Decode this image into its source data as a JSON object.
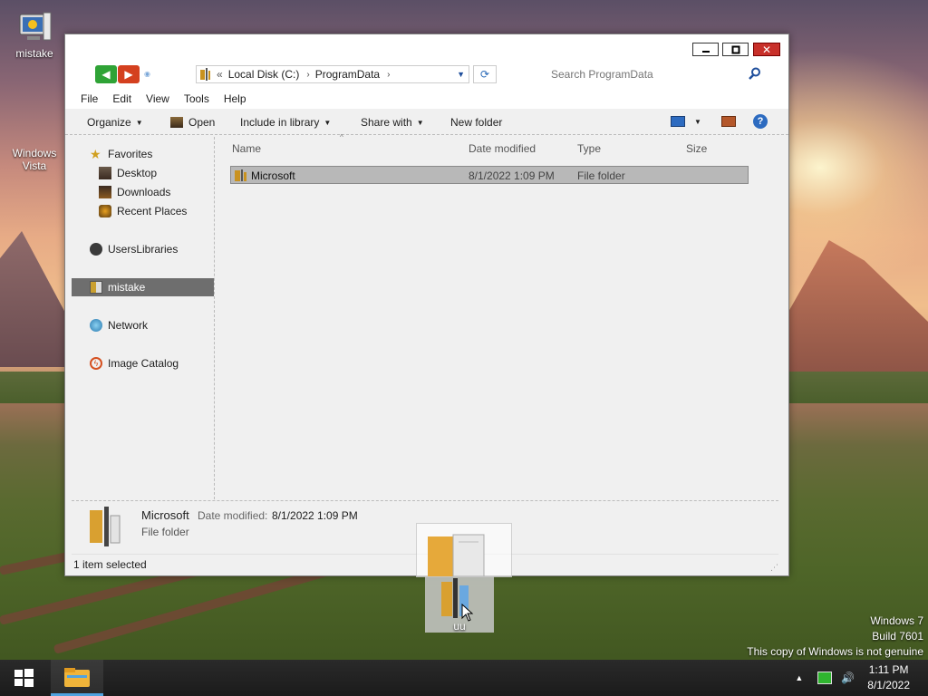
{
  "desktop": {
    "icons": [
      {
        "label": "mistake",
        "icon": "computer-icon"
      },
      {
        "label": "Windows Vista",
        "icon": "text-shortcut"
      }
    ],
    "watermark": {
      "line1": "Windows 7",
      "line2": "Build 7601",
      "line3": "This copy of Windows is not genuine"
    }
  },
  "explorer": {
    "address": {
      "overflow": "«",
      "crumbs": [
        "Local Disk (C:)",
        "ProgramData"
      ]
    },
    "search": {
      "placeholder": "Search ProgramData"
    },
    "menu": [
      "File",
      "Edit",
      "View",
      "Tools",
      "Help"
    ],
    "toolbar": {
      "organize": "Organize",
      "open": "Open",
      "include": "Include in library",
      "share": "Share with",
      "new_folder": "New folder"
    },
    "nav": [
      {
        "label": "Favorites",
        "icon": "star-icon"
      },
      {
        "label": "Desktop",
        "icon": "desktop-icon"
      },
      {
        "label": "Downloads",
        "icon": "downloads-icon"
      },
      {
        "label": "Recent Places",
        "icon": "recent-places-icon"
      },
      {
        "label": "UsersLibraries",
        "icon": "libraries-icon"
      },
      {
        "label": "mistake",
        "icon": "computer-icon",
        "selected": true
      },
      {
        "label": "Network",
        "icon": "network-icon"
      },
      {
        "label": "Image Catalog",
        "icon": "image-catalog-icon"
      }
    ],
    "columns": [
      "Name",
      "Date modified",
      "Type",
      "Size"
    ],
    "files": [
      {
        "name": "Microsoft",
        "date": "8/1/2022 1:09 PM",
        "type": "File folder",
        "size": ""
      }
    ],
    "details": {
      "name": "Microsoft",
      "date_label": "Date modified:",
      "date_value": "8/1/2022 1:09 PM",
      "type": "File folder"
    },
    "status": "1 item selected"
  },
  "drag": {
    "label": "uu"
  },
  "taskbar": {
    "time": "1:11 PM",
    "date": "8/1/2022"
  },
  "colors": {
    "selection": "#6e6e6e",
    "close": "#c8302a",
    "taskbar_accent": "#4fa3e0"
  }
}
